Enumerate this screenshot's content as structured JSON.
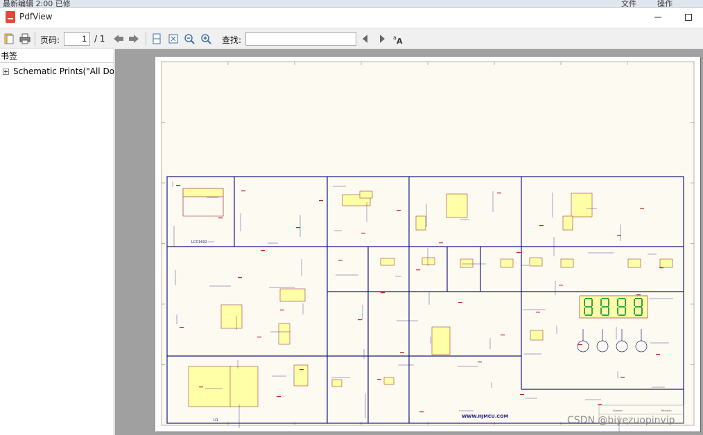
{
  "background_strip": {
    "text_left": "最新编辑     2:00 已修",
    "menu_file": "文件",
    "menu_ops": "操作"
  },
  "window": {
    "title": "PdfView",
    "minimize_icon": "minimize-icon",
    "maximize_icon": "maximize-icon"
  },
  "toolbar": {
    "page_label": "页码:",
    "page_current": "1",
    "page_total": "/ 1",
    "find_label": "查找:",
    "find_value": "",
    "icons": [
      "open-icon",
      "print-icon",
      "back-icon",
      "forward-icon",
      "fit-width-icon",
      "fit-page-icon",
      "zoom-out-icon",
      "zoom-in-icon",
      "find-prev-icon",
      "find-next-icon",
      "match-case-icon"
    ]
  },
  "sidebar": {
    "header": "书签",
    "items": [
      {
        "label": "Schematic Prints(\"All Doc"
      }
    ]
  },
  "schematic": {
    "lcd_label": "LCD1602",
    "footer_url": "WWW.HJMCU.COM",
    "mcu_label": "U1",
    "title_block_number": "Number",
    "title_block_revision": "Revision"
  },
  "watermark": "CSDN @biyezuopinvip",
  "colors": {
    "frame_blue": "#1a1a7a",
    "component_yellow": "#ffffa8",
    "segment_green": "#2aa84a",
    "page_tint": "#fdfaf2"
  }
}
